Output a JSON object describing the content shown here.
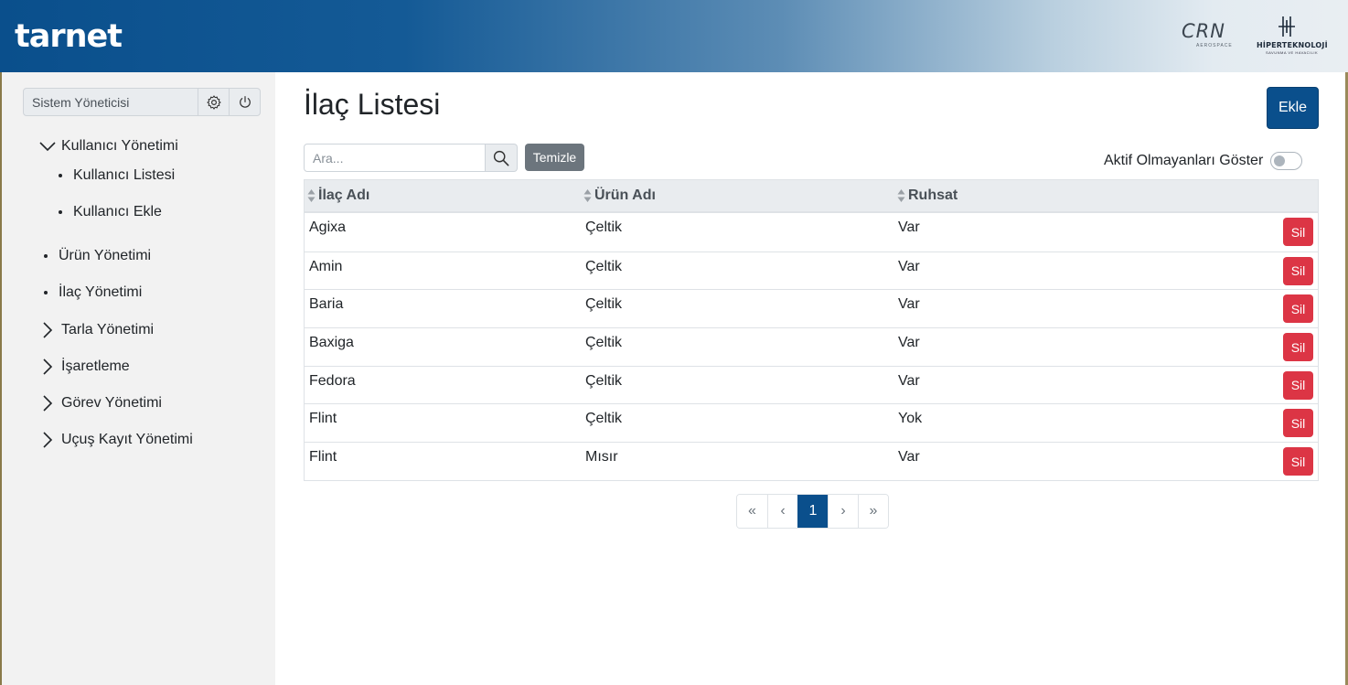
{
  "header": {
    "logo": "tarnet",
    "partner_crn": "CRN",
    "partner_crn_sub": "AEROSPACE",
    "partner_hip": "HİPERTEKNOLOJİ",
    "partner_hip_sub": "SAVUNMA VE HAVACILIK"
  },
  "sidebar": {
    "user_name": "Sistem Yöneticisi",
    "items": [
      {
        "label": "Kullanıcı Yönetimi",
        "kind": "expanded"
      },
      {
        "label": "Kullanıcı Listesi",
        "kind": "sub"
      },
      {
        "label": "Kullanıcı Ekle",
        "kind": "sub"
      },
      {
        "label": "Ürün Yönetimi",
        "kind": "bullet"
      },
      {
        "label": "İlaç Yönetimi",
        "kind": "bullet"
      },
      {
        "label": "Tarla Yönetimi",
        "kind": "collapsed"
      },
      {
        "label": "İşaretleme",
        "kind": "collapsed"
      },
      {
        "label": "Görev Yönetimi",
        "kind": "collapsed"
      },
      {
        "label": "Uçuş Kayıt Yönetimi",
        "kind": "collapsed"
      }
    ]
  },
  "main": {
    "title": "İlaç Listesi",
    "add_label": "Ekle",
    "search_placeholder": "Ara...",
    "clear_label": "Temizle",
    "toggle_label": "Aktif Olmayanları Göster",
    "toggle_on": false
  },
  "table": {
    "columns": [
      "İlaç Adı",
      "Ürün Adı",
      "Ruhsat"
    ],
    "delete_label": "Sil",
    "rows": [
      [
        "Agixa",
        "Çeltik",
        "Var"
      ],
      [
        "Amin",
        "Çeltik",
        "Var"
      ],
      [
        "Baria",
        "Çeltik",
        "Var"
      ],
      [
        "Baxiga",
        "Çeltik",
        "Var"
      ],
      [
        "Fedora",
        "Çeltik",
        "Var"
      ],
      [
        "Flint",
        "Çeltik",
        "Yok"
      ],
      [
        "Flint",
        "Mısır",
        "Var"
      ]
    ]
  },
  "pagination": {
    "first": "«",
    "prev": "‹",
    "current": "1",
    "next": "›",
    "last": "»"
  },
  "colors": {
    "primary": "#0a4f8c",
    "danger": "#dc3545",
    "secondary": "#6c757d"
  }
}
